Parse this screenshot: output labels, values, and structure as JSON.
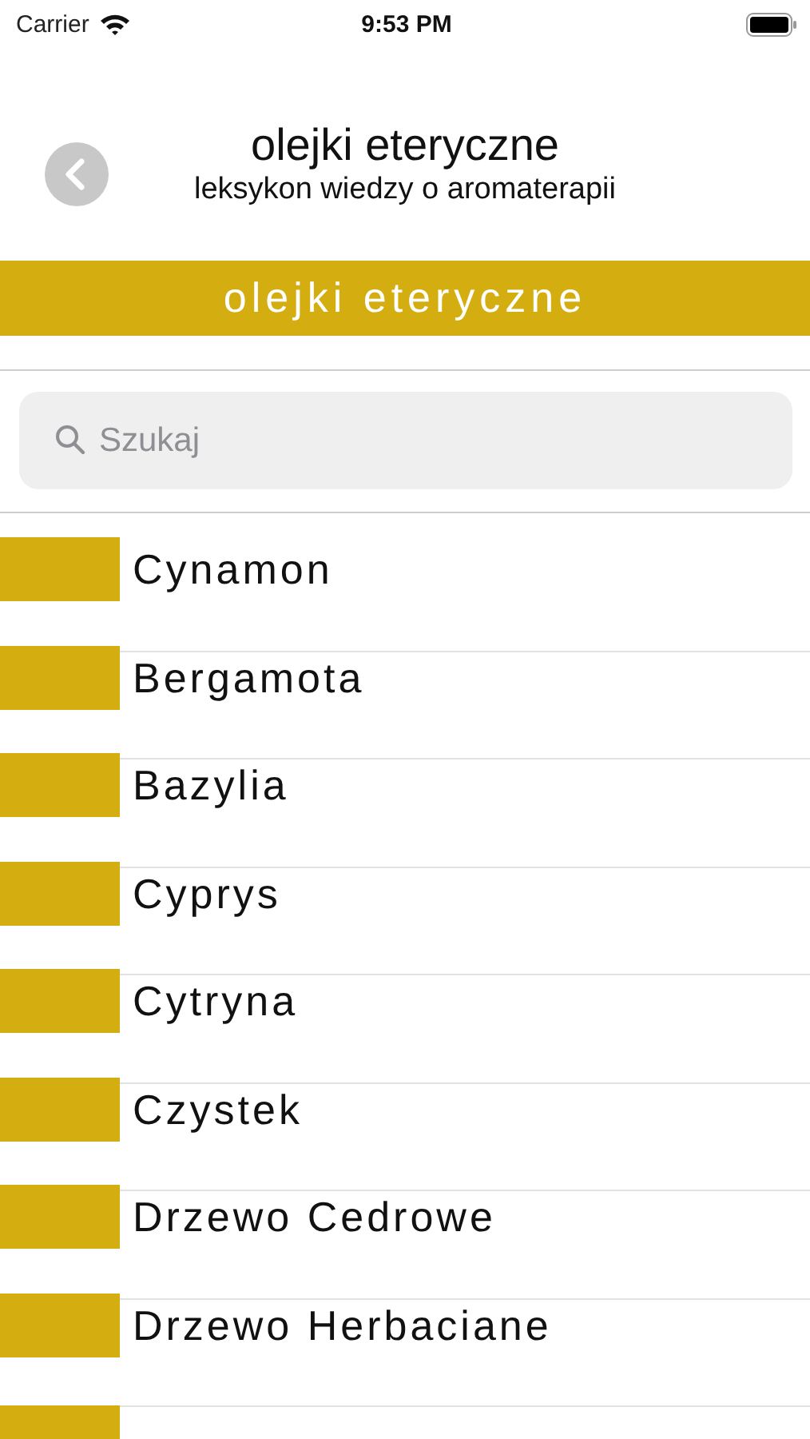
{
  "status_bar": {
    "carrier": "Carrier",
    "time": "9:53 PM"
  },
  "header": {
    "title": "olejki eteryczne",
    "subtitle": "leksykon wiedzy o aromaterapii"
  },
  "banner": {
    "title": "olejki eteryczne"
  },
  "search": {
    "placeholder": "Szukaj"
  },
  "items": [
    {
      "name": "Cynamon"
    },
    {
      "name": "Bergamota"
    },
    {
      "name": "Bazylia"
    },
    {
      "name": "Cyprys"
    },
    {
      "name": "Cytryna"
    },
    {
      "name": "Czystek"
    },
    {
      "name": "Drzewo Cedrowe"
    },
    {
      "name": "Drzewo Herbaciane"
    }
  ]
}
